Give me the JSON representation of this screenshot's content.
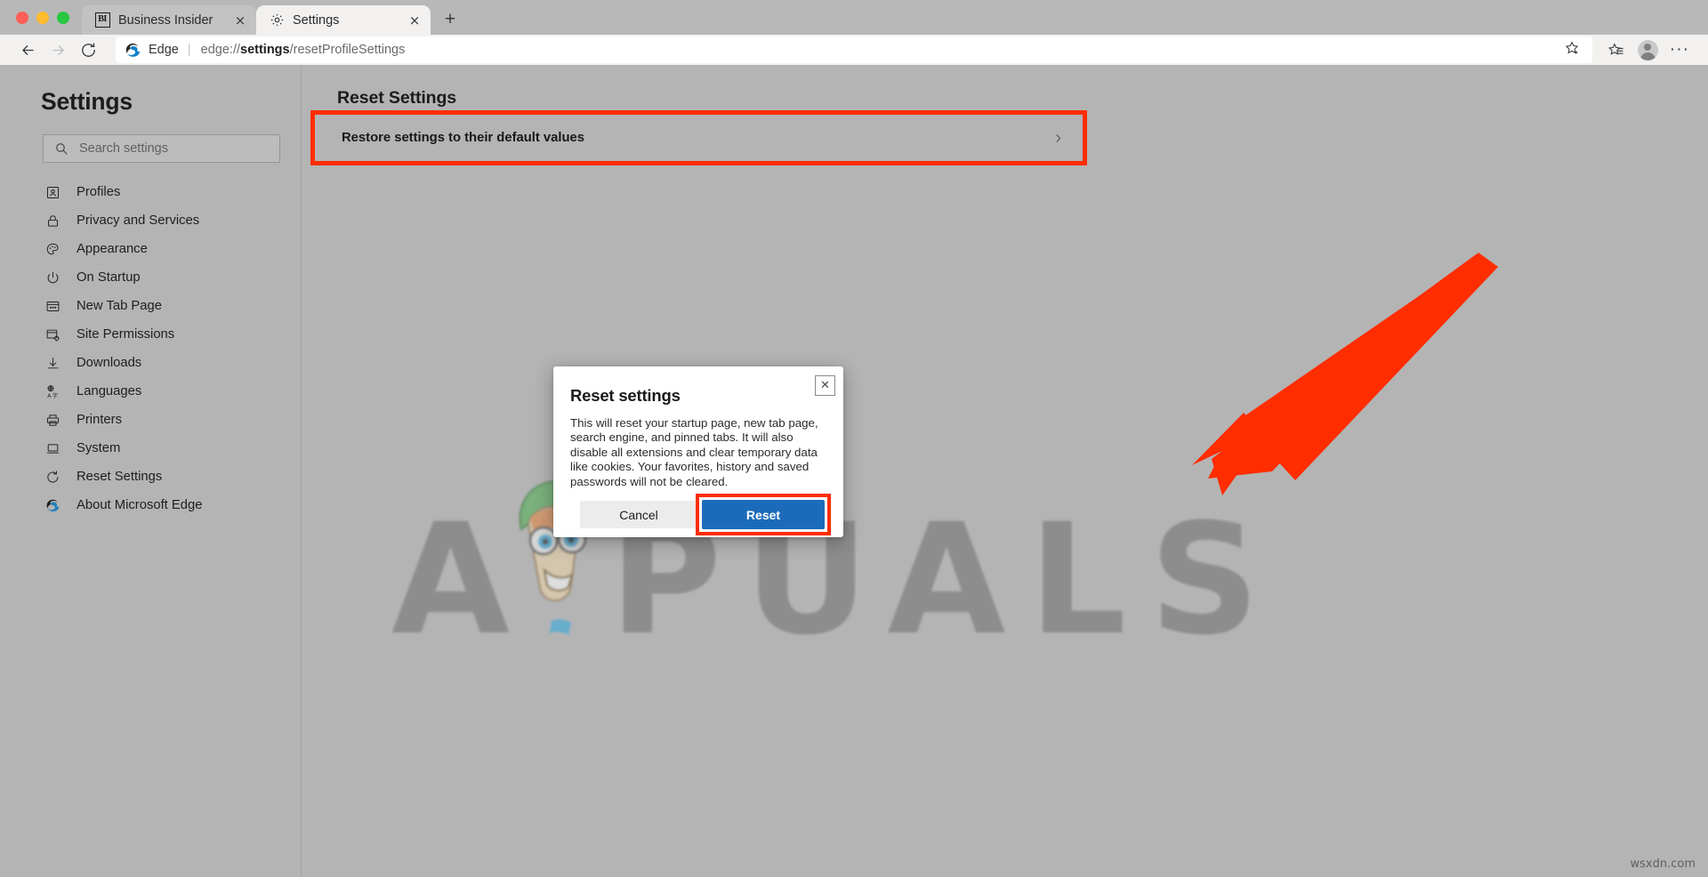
{
  "window": {
    "traffic_lights": [
      "close",
      "minimize",
      "maximize"
    ]
  },
  "tabs": [
    {
      "title": "Business Insider",
      "favicon": "bi-logo-icon",
      "active": false,
      "close_label": "×"
    },
    {
      "title": "Settings",
      "favicon": "gear-icon",
      "active": true,
      "close_label": "×"
    }
  ],
  "new_tab_label": "+",
  "toolbar": {
    "back_label": "←",
    "forward_label": "→",
    "reload_label": "↺",
    "brand": "Edge",
    "separator": "|",
    "url_prefix": "edge://",
    "url_bold": "settings",
    "url_suffix": "/resetProfileSettings",
    "full_url": "edge://settings/resetProfileSettings",
    "favorite_icon": "star-plus-icon",
    "favorites_list_icon": "favorites-list-icon",
    "profile_icon": "profile-avatar-icon",
    "more_icon": "more-options-icon",
    "more_label": "···"
  },
  "sidebar": {
    "title": "Settings",
    "search": {
      "placeholder": "Search settings",
      "value": "",
      "icon": "search-icon"
    },
    "items": [
      {
        "label": "Profiles",
        "icon": "profiles-icon"
      },
      {
        "label": "Privacy and Services",
        "icon": "lock-icon"
      },
      {
        "label": "Appearance",
        "icon": "palette-icon"
      },
      {
        "label": "On Startup",
        "icon": "power-icon"
      },
      {
        "label": "New Tab Page",
        "icon": "new-tab-page-icon"
      },
      {
        "label": "Site Permissions",
        "icon": "site-permissions-icon"
      },
      {
        "label": "Downloads",
        "icon": "download-arrow-icon"
      },
      {
        "label": "Languages",
        "icon": "languages-icon"
      },
      {
        "label": "Printers",
        "icon": "printer-icon"
      },
      {
        "label": "System",
        "icon": "laptop-icon"
      },
      {
        "label": "Reset Settings",
        "icon": "reset-circular-arrow-icon"
      },
      {
        "label": "About Microsoft Edge",
        "icon": "edge-logo-icon"
      }
    ]
  },
  "main": {
    "heading": "Reset Settings",
    "restore_row": {
      "label": "Restore settings to their default values",
      "chevron": "›",
      "highlight_color": "#ff2d00"
    }
  },
  "dialog": {
    "title": "Reset settings",
    "body": "This will reset your startup page, new tab page, search engine, and pinned tabs. It will also disable all extensions and clear temporary data like cookies. Your favorites, history and saved passwords will not be cleared.",
    "close_label": "✕",
    "cancel_label": "Cancel",
    "reset_label": "Reset",
    "reset_color": "#1c6bba",
    "highlight_color": "#ff2d00"
  },
  "annotations": {
    "arrow_color": "#ff2d00",
    "arrow_description": "red arrow pointing to Reset button"
  },
  "watermark": {
    "text": "A PUALS",
    "mascot": "appuals-mascot-icon",
    "corner_text": "wsxdn.com"
  }
}
